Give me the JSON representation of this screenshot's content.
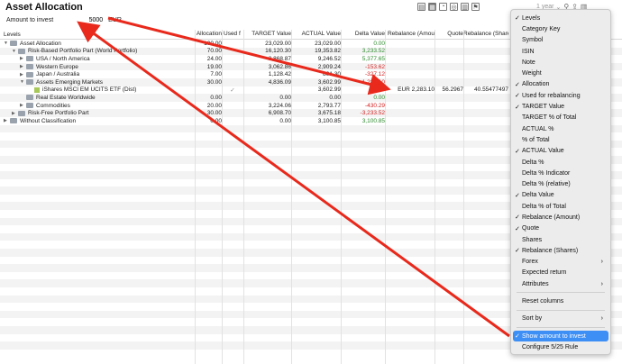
{
  "title": "Asset Allocation",
  "toolbar": {
    "range": "1 year",
    "icons": [
      "table-icon",
      "treemap-icon",
      "pie-icon",
      "globe-icon",
      "bar-icon",
      "flag-icon"
    ]
  },
  "invest": {
    "label": "Amount to invest",
    "value": "5000",
    "currency": "EUR"
  },
  "columns": {
    "levels": "Levels",
    "allocation": "Allocation",
    "used": "Used f",
    "target_value": "TARGET Value",
    "actual_value": "ACTUAL Value",
    "delta_value": "Delta Value",
    "rebalance_amount": "Rebalance (Amou",
    "quote": "Quote",
    "rebalance_shares": "Rebalance (Shares"
  },
  "rows": [
    {
      "name": "Asset Allocation",
      "indent": 0,
      "arrow": "▼",
      "icon": "folder",
      "allocation": "100.00",
      "used": "",
      "target": "23,029.00",
      "actual": "23,029.00",
      "delta": "0.00",
      "delta_sign": "pos",
      "ramount": "",
      "quote": "",
      "rshares": ""
    },
    {
      "name": "Risk-Based Portfolio Part (World Portfolio)",
      "indent": 1,
      "arrow": "▼",
      "icon": "folder",
      "allocation": "70.00",
      "used": "",
      "target": "16,120.30",
      "actual": "19,353.82",
      "delta": "3,233.52",
      "delta_sign": "pos",
      "ramount": "",
      "quote": "",
      "rshares": ""
    },
    {
      "name": "USA / North America",
      "indent": 2,
      "arrow": "▶",
      "icon": "folder",
      "allocation": "24.00",
      "used": "",
      "target": "3,868.87",
      "actual": "9,246.52",
      "delta": "5,377.65",
      "delta_sign": "pos",
      "ramount": "",
      "quote": "",
      "rshares": ""
    },
    {
      "name": "Western Europe",
      "indent": 2,
      "arrow": "▶",
      "icon": "folder",
      "allocation": "19.00",
      "used": "",
      "target": "3,062.86",
      "actual": "2,909.24",
      "delta": "-153.62",
      "delta_sign": "neg",
      "ramount": "",
      "quote": "",
      "rshares": ""
    },
    {
      "name": "Japan / Australia",
      "indent": 2,
      "arrow": "▶",
      "icon": "folder",
      "allocation": "7.00",
      "used": "",
      "target": "1,128.42",
      "actual": "801.30",
      "delta": "-327.12",
      "delta_sign": "neg",
      "ramount": "",
      "quote": "",
      "rshares": ""
    },
    {
      "name": "Assets Emerging Markets",
      "indent": 2,
      "arrow": "▼",
      "icon": "folder",
      "allocation": "30.00",
      "used": "",
      "target": "4,836.09",
      "actual": "3,602.99",
      "delta": "-1,233.10",
      "delta_sign": "neg",
      "ramount": "",
      "quote": "",
      "rshares": ""
    },
    {
      "name": "iShares MSCI EM UCITS ETF (Dist)",
      "indent": 3,
      "arrow": "",
      "icon": "sec",
      "allocation": "",
      "used": "✓",
      "target": "",
      "actual": "3,602.99",
      "delta": "",
      "delta_sign": "",
      "ramount": "EUR 2,283.10",
      "quote": "56.2967",
      "rshares": "40.55477497"
    },
    {
      "name": "Real Estate Worldwide",
      "indent": 2,
      "arrow": "",
      "icon": "folder",
      "allocation": "0.00",
      "used": "",
      "target": "0.00",
      "actual": "0.00",
      "delta": "0.00",
      "delta_sign": "pos",
      "ramount": "",
      "quote": "",
      "rshares": ""
    },
    {
      "name": "Commodities",
      "indent": 2,
      "arrow": "▶",
      "icon": "folder",
      "allocation": "20.00",
      "used": "",
      "target": "3,224.06",
      "actual": "2,793.77",
      "delta": "-430.29",
      "delta_sign": "neg",
      "ramount": "",
      "quote": "",
      "rshares": ""
    },
    {
      "name": "Risk-Free Portfolio Part",
      "indent": 1,
      "arrow": "▶",
      "icon": "folder",
      "allocation": "30.00",
      "used": "",
      "target": "6,908.70",
      "actual": "3,675.18",
      "delta": "-3,233.52",
      "delta_sign": "neg",
      "ramount": "",
      "quote": "",
      "rshares": ""
    },
    {
      "name": "Without Classification",
      "indent": 0,
      "arrow": "▶",
      "icon": "folder",
      "allocation": "0.00",
      "used": "",
      "target": "0.00",
      "actual": "3,100.85",
      "delta": "3,100.85",
      "delta_sign": "pos",
      "ramount": "",
      "quote": "",
      "rshares": ""
    }
  ],
  "empty_rows": 29,
  "menu": [
    {
      "label": "Levels",
      "checked": true
    },
    {
      "label": "Category Key",
      "checked": false
    },
    {
      "label": "Symbol",
      "checked": false
    },
    {
      "label": "ISIN",
      "checked": false
    },
    {
      "label": "Note",
      "checked": false
    },
    {
      "label": "Weight",
      "checked": false
    },
    {
      "label": "Allocation",
      "checked": true
    },
    {
      "label": "Used for rebalancing",
      "checked": true
    },
    {
      "label": "TARGET Value",
      "checked": true
    },
    {
      "label": "TARGET % of Total",
      "checked": false
    },
    {
      "label": "ACTUAL %",
      "checked": false
    },
    {
      "label": "% of Total",
      "checked": false
    },
    {
      "label": "ACTUAL Value",
      "checked": true
    },
    {
      "label": "Delta %",
      "checked": false
    },
    {
      "label": "Delta % Indicator",
      "checked": false
    },
    {
      "label": "Delta % (relative)",
      "checked": false
    },
    {
      "label": "Delta Value",
      "checked": true
    },
    {
      "label": "Delta % of Total",
      "checked": false
    },
    {
      "label": "Rebalance (Amount)",
      "checked": true
    },
    {
      "label": "Quote",
      "checked": true
    },
    {
      "label": "Shares",
      "checked": false
    },
    {
      "label": "Rebalance (Shares)",
      "checked": true
    },
    {
      "label": "Forex",
      "checked": false,
      "submenu": true
    },
    {
      "label": "Expected return",
      "checked": false
    },
    {
      "label": "Attributes",
      "checked": false,
      "submenu": true
    },
    {
      "sep": true
    },
    {
      "label": "Reset columns",
      "checked": false
    },
    {
      "sep": true
    },
    {
      "label": "Sort by",
      "checked": false,
      "submenu": true
    },
    {
      "sep": true
    },
    {
      "label": "Show amount to invest",
      "checked": true,
      "highlight": true
    },
    {
      "label": "Configure 5/25 Rule",
      "checked": false
    }
  ],
  "colors": {
    "arrow": "#e8291c",
    "highlight": "#3d8ef5",
    "positive": "#2e8b2e",
    "negative": "#d62020"
  }
}
